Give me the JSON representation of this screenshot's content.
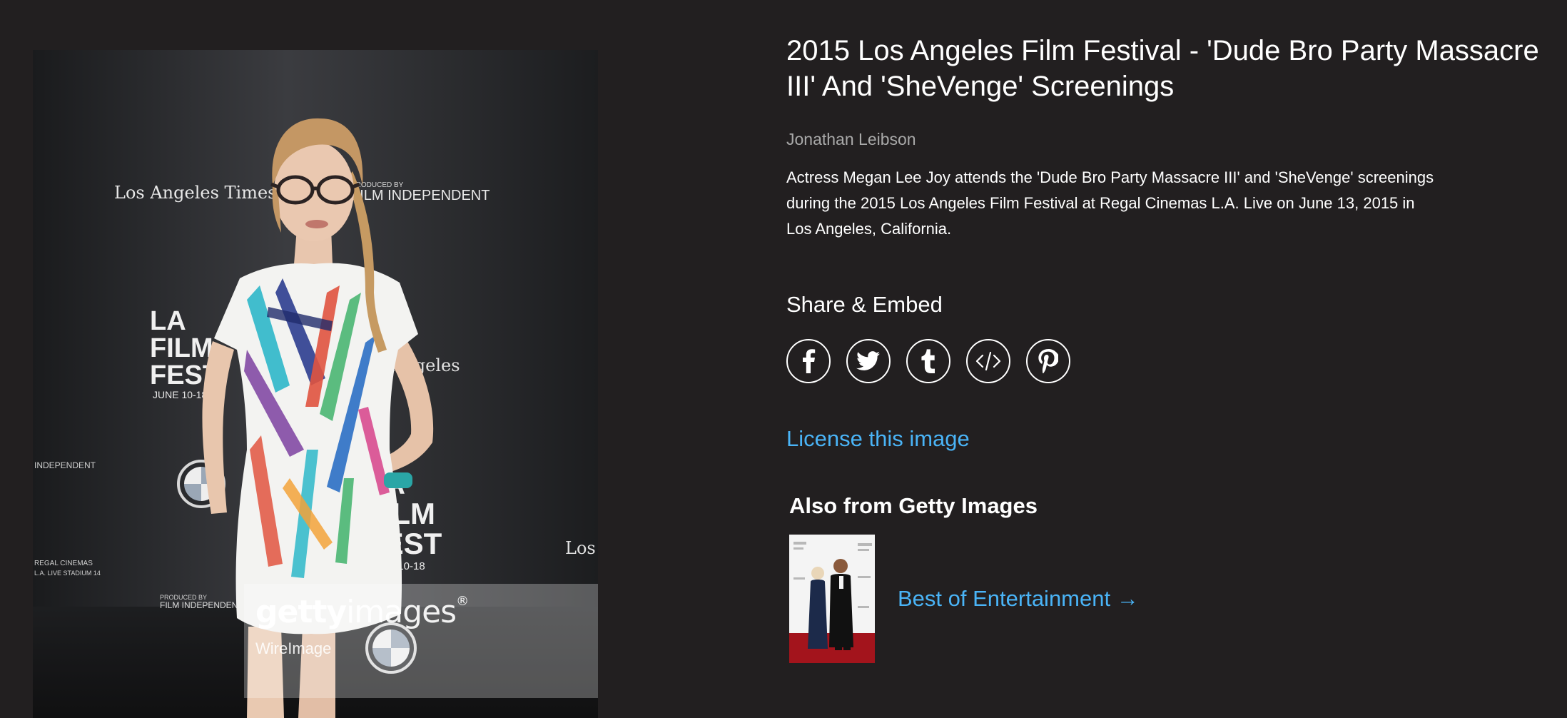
{
  "image": {
    "backdrop_text": {
      "lat_logo": "Los Angeles Times",
      "presented_by": "PRODUCED BY",
      "film_independent": "FILM INDEPENDENT",
      "la": "LA",
      "film": "FILM",
      "fest": "FEST",
      "dates": "JUNE 10-18",
      "angeles": "Angeles",
      "los": "Los",
      "bmw": "BMW",
      "regal": "REGAL CINEMAS",
      "stadium": "L.A. LIVE STADIUM 14",
      "independent_small": "INDEPENDENT"
    },
    "watermark": {
      "brand_bold": "getty",
      "brand_regular": "images",
      "registered": "®",
      "sub": "WireImage"
    }
  },
  "detail": {
    "title": "2015 Los Angeles Film Festival - 'Dude Bro Party Massacre III' And 'SheVenge' Screenings",
    "photographer": "Jonathan Leibson",
    "caption": "Actress Megan Lee Joy attends the 'Dude Bro Party Massacre III' and 'SheVenge' screenings during the 2015 Los Angeles Film Festival at Regal Cinemas L.A. Live on June 13, 2015 in Los Angeles, California."
  },
  "share": {
    "heading": "Share & Embed",
    "buttons": [
      {
        "name": "facebook",
        "icon": "facebook-icon"
      },
      {
        "name": "twitter",
        "icon": "twitter-icon"
      },
      {
        "name": "tumblr",
        "icon": "tumblr-icon"
      },
      {
        "name": "embed",
        "icon": "code-icon"
      },
      {
        "name": "pinterest",
        "icon": "pinterest-icon"
      }
    ]
  },
  "license_link": "License this image",
  "also_from": {
    "heading": "Also from Getty Images",
    "link": "Best of Entertainment →"
  },
  "colors": {
    "background": "#221f20",
    "link": "#4ab4f7",
    "muted_text": "#a9a9a9"
  }
}
